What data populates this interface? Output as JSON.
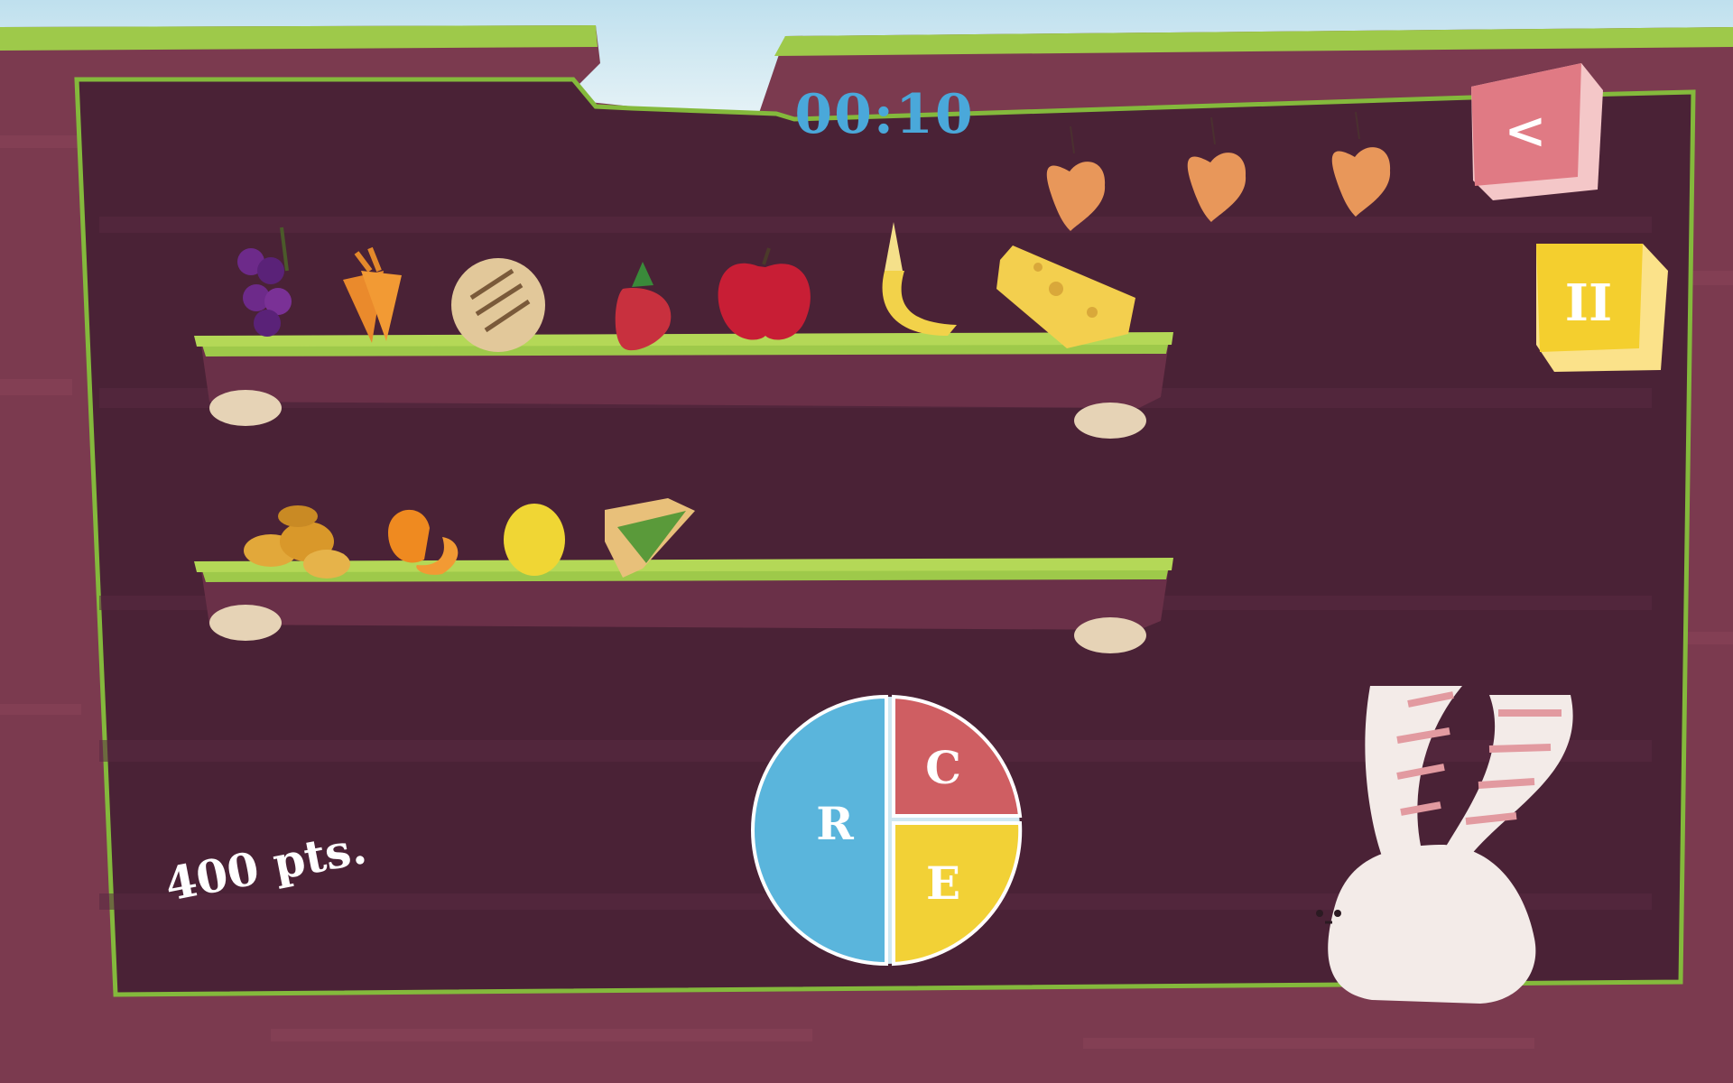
{
  "hud": {
    "timer": "00:10",
    "score": "400 pts."
  },
  "controls": {
    "back_label": "<",
    "pause_label": "II"
  },
  "lives": {
    "remaining": 3,
    "icon": "leaf-icon"
  },
  "shelves": [
    {
      "items": [
        "grapes",
        "carrots",
        "cookie",
        "strawberry",
        "apple",
        "banana",
        "cheese"
      ]
    },
    {
      "items": [
        "bread-rolls",
        "orange",
        "lemon",
        "sandwich"
      ]
    }
  ],
  "plate": {
    "sections": [
      {
        "letter": "R",
        "color": "#5ab5dc"
      },
      {
        "letter": "C",
        "color": "#cf5e62"
      },
      {
        "letter": "E",
        "color": "#f2d136"
      }
    ]
  },
  "colors": {
    "soil": "#4a2236",
    "soil_edge": "#7b3a4f",
    "grass": "#9ec94a",
    "timer": "#4aa8da",
    "back_button": "#e07a84",
    "pause_button": "#f4cf2e"
  }
}
